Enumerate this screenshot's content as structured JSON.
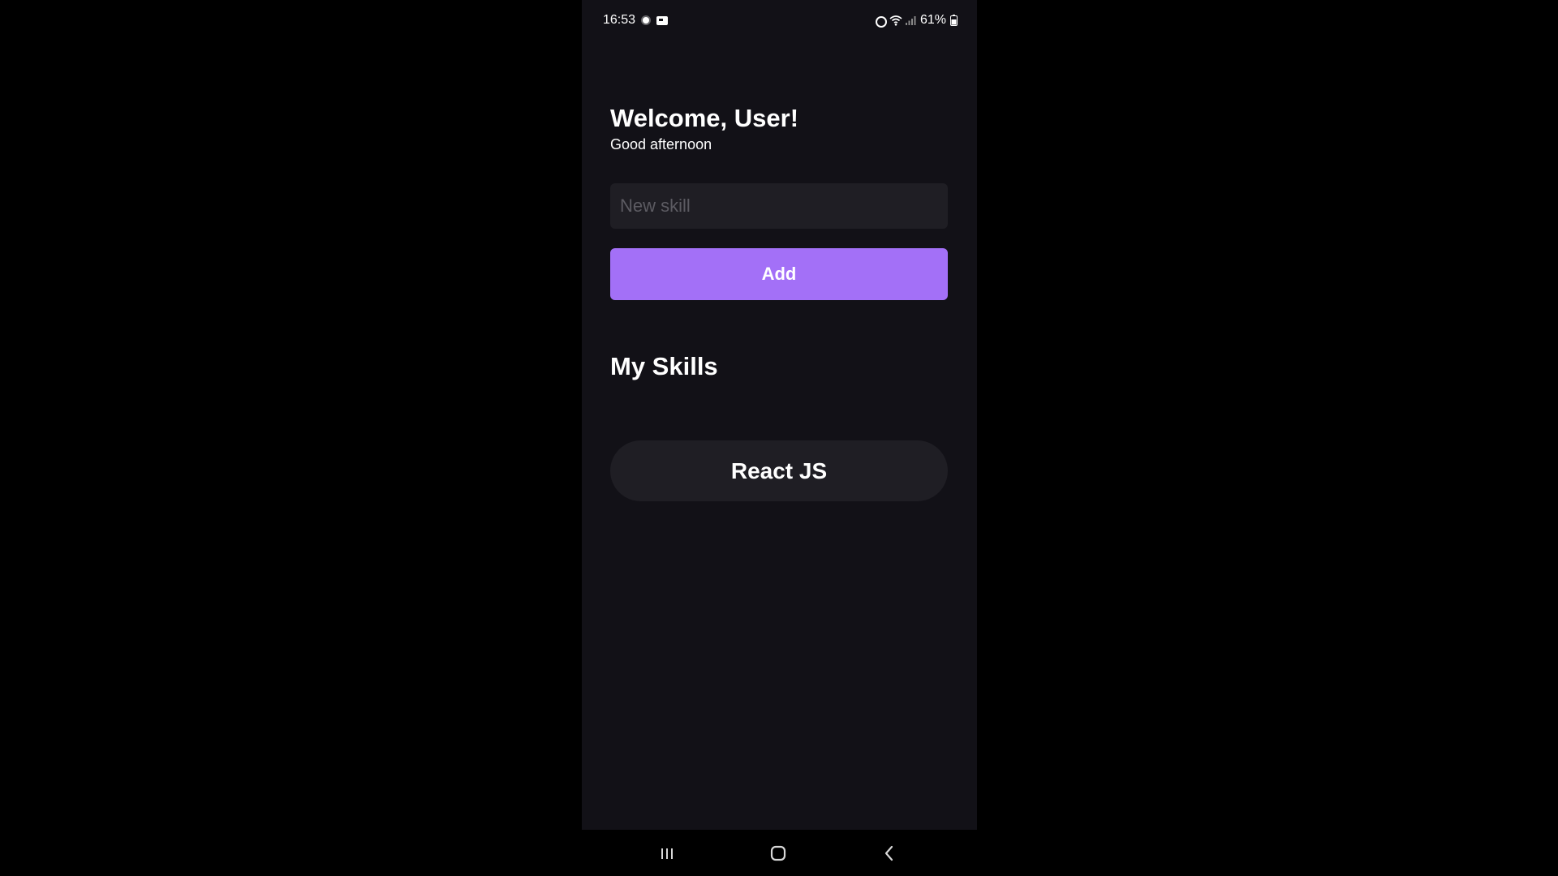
{
  "status_bar": {
    "time": "16:53",
    "battery": "61%",
    "left_icons": [
      "sun-icon",
      "card-icon"
    ],
    "right_icons": [
      "alarm-icon",
      "wifi-icon",
      "signal-icon",
      "battery-icon"
    ]
  },
  "header": {
    "welcome": "Welcome, User!",
    "greeting": "Good afternoon"
  },
  "form": {
    "input_placeholder": "New skill",
    "input_value": "",
    "add_label": "Add"
  },
  "skills": {
    "title": "My Skills",
    "items": [
      {
        "label": "React JS"
      }
    ]
  },
  "nav": {
    "icons": [
      "recent-apps-icon",
      "home-icon",
      "back-icon"
    ]
  },
  "colors": {
    "background": "#121117",
    "accent": "#a370f7",
    "surface": "#1f1e24",
    "text": "#ffffff",
    "placeholder": "#5c5b62"
  }
}
